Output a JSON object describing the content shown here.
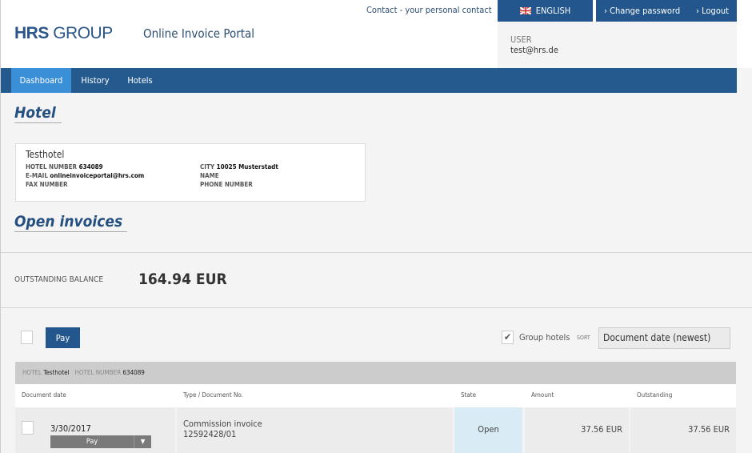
{
  "header": {
    "logo_bold": "HRS",
    "logo_light": "GROUP",
    "portal_title": "Online Invoice Portal",
    "contact_link": "Contact - your personal contact",
    "language": "ENGLISH",
    "change_password": "Change password",
    "logout": "Logout",
    "user_label": "USER",
    "user_email": "test@hrs.de"
  },
  "nav": {
    "items": [
      {
        "label": "Dashboard",
        "active": true
      },
      {
        "label": "History"
      },
      {
        "label": "Hotels"
      }
    ]
  },
  "hotel": {
    "heading": "Hotel",
    "name": "Testhotel",
    "hotel_number_label": "HOTEL NUMBER",
    "hotel_number": "634089",
    "email_label": "E-MAIL",
    "email": "onlineinvoiceportal@hrs.com",
    "fax_label": "FAX NUMBER",
    "city_label": "CITY",
    "city": "10025 Musterstadt",
    "name_label": "NAME",
    "phone_label": "PHONE NUMBER"
  },
  "invoices": {
    "heading": "Open invoices",
    "balance_label": "OUTSTANDING BALANCE",
    "balance": "164.94 EUR",
    "pay_label": "Pay",
    "group_hotels_label": "Group hotels",
    "group_hotels_checked": true,
    "sort_label": "SORT",
    "sort_value": "Document date (newest)",
    "group": {
      "hotel_label": "HOTEL",
      "hotel": "Testhotel",
      "number_label": "HOTEL NUMBER",
      "number": "634089"
    },
    "columns": [
      "Document date",
      "Type / Document No.",
      "State",
      "Amount",
      "Outstanding"
    ],
    "rows": [
      {
        "date": "3/30/2017",
        "pay_label": "Pay",
        "type": "Commission invoice",
        "doc_no": "12592428/01",
        "state": "Open",
        "amount": "37.56 EUR",
        "outstanding": "37.56 EUR"
      }
    ]
  },
  "colors": {
    "brand": "#23568c",
    "nav_active": "#3b8fd6",
    "state_open_bg": "#d9ebf5"
  }
}
